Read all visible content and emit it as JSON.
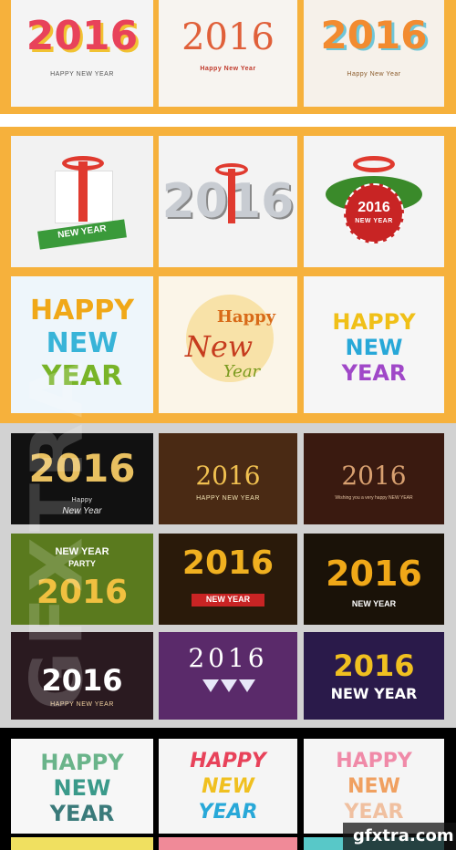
{
  "tiles": [
    {
      "big": "2016",
      "small": "HAPPY NEW YEAR",
      "bg": "#f4f4f4",
      "c1": "#e8425a",
      "c2": "#f1c232",
      "sc": "#555555"
    },
    {
      "big": "2016",
      "small": "Happy New Year",
      "bg": "#f7f4f0",
      "c1": "#e0603a",
      "c2": "#f2a03a",
      "sc": "#c0392b"
    },
    {
      "big": "2016",
      "small": "Happy New Year",
      "bg": "#f6f1ea",
      "c1": "#f28b30",
      "c2": "#6fc6d8",
      "sc": "#8a5a2a"
    },
    {
      "big": "",
      "small": "NEW YEAR",
      "bg": "#f2f2f2",
      "c1": "#e03a2f",
      "c2": "#3a9a3a",
      "sc": "#ffffff"
    },
    {
      "big": "2016",
      "small": "",
      "bg": "#f3f3f3",
      "c1": "#c8ccd2",
      "c2": "#e03a2f",
      "sc": "#333333"
    },
    {
      "big": "2016",
      "small": "NEW YEAR",
      "bg": "#f4f4f4",
      "c1": "#ffffff",
      "c2": "#c82424",
      "sc": "#ffffff"
    },
    {
      "big": "HAPPY",
      "mid": "NEW",
      "big2": "YEAR",
      "bg": "#eef6fb",
      "c1": "#f0a818",
      "c2": "#38b4d8",
      "c3": "#78b428"
    },
    {
      "big": "Happy",
      "mid": "New",
      "big2": "Year",
      "bg": "#fbf5e8",
      "c1": "#d86a18",
      "c2": "#c63c1e",
      "c3": "#7a9a1e"
    },
    {
      "big": "HAPPY",
      "mid": "NEW",
      "big2": "YEAR",
      "bg": "#f6f6f6",
      "c1": "#f0c018",
      "c2": "#28a8d8",
      "c3": "#a048c8"
    },
    {
      "big": "2016",
      "small": "Happy",
      "small2": "New Year",
      "bg": "#111111",
      "c1": "#e8c060",
      "sc": "#e8e8e8"
    },
    {
      "big": "2016",
      "small": "HAPPY NEW YEAR",
      "bg": "#4a2a14",
      "c1": "#f0c050",
      "sc": "#f0e0b0"
    },
    {
      "big": "2016",
      "small": "Wishing you a very happy NEW YEAR",
      "bg": "#3a1a10",
      "c1": "#d8a070",
      "sc": "#e0c0a0"
    },
    {
      "big": "2016",
      "small": "NEW YEAR",
      "small2": "PARTY",
      "bg": "#5a7a1e",
      "c1": "#f0c040",
      "sc": "#ffffff"
    },
    {
      "big": "2016",
      "small": "NEW YEAR",
      "bg": "#2a1a0a",
      "c1": "#f0b020",
      "sc": "#ffffff"
    },
    {
      "big": "2016",
      "small": "NEW YEAR",
      "bg": "#1a1208",
      "c1": "#f0a818",
      "sc": "#ffffff"
    },
    {
      "big": "2016",
      "small": "HAPPY NEW YEAR",
      "bg": "#2a1a20",
      "c1": "#ffffff",
      "sc": "#f0d0a0"
    },
    {
      "big": "2016",
      "small": "",
      "bg": "#5a2a6a",
      "c1": "#ffffff",
      "sc": "#ffffff"
    },
    {
      "big": "2016",
      "small": "NEW YEAR",
      "bg": "#2a1a4a",
      "c1": "#f0c020",
      "sc": "#ffffff"
    },
    {
      "big": "HAPPY",
      "mid": "NEW",
      "big2": "YEAR",
      "bg": "#f7f7f7",
      "c1": "#6ab48a",
      "c2": "#3a9a8a",
      "c3": "#3a7a7a"
    },
    {
      "big": "HAPPY",
      "mid": "NEW",
      "big2": "YEAR",
      "bg": "#f5f5f5",
      "c1": "#e8425a",
      "c2": "#f0c020",
      "c3": "#28a8d8"
    },
    {
      "big": "HAPPY",
      "mid": "NEW",
      "big2": "YEAR",
      "bg": "#f5f5f5",
      "c1": "#f08aa8",
      "c2": "#f0a060",
      "c3": "#f0c0a0"
    }
  ],
  "watermark": "GFXTRA",
  "logo": "gfxtra.com",
  "colors": {
    "orange": "#f6b13c",
    "dark": "#2a2a2a",
    "black": "#000000"
  }
}
